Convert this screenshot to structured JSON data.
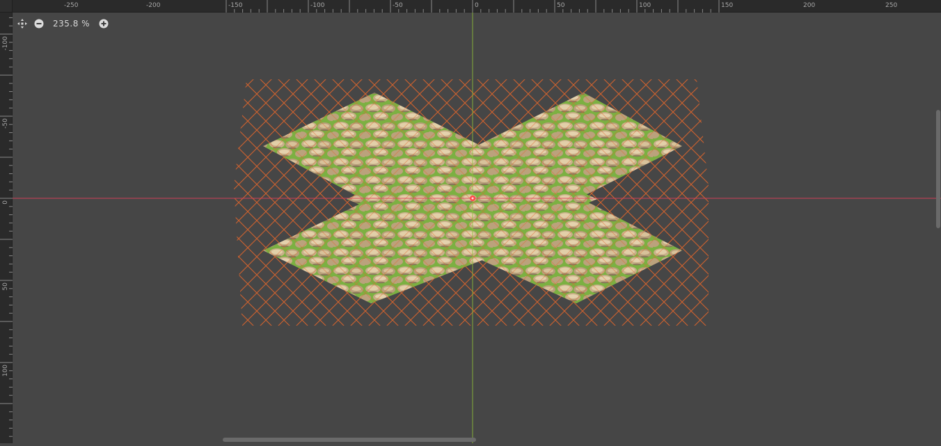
{
  "zoom": {
    "value": "235.8 %",
    "icons": {
      "center": "center-view-icon",
      "out": "zoom-out-icon",
      "in": "zoom-in-icon"
    }
  },
  "rulers": {
    "horizontal_labels": [
      "-250",
      "-200",
      "-150",
      "-100",
      "-50",
      "0",
      "50",
      "100",
      "150",
      "200",
      "250"
    ],
    "vertical_labels": [
      "-100",
      "-50",
      "0",
      "50",
      "100"
    ]
  },
  "colors": {
    "canvas": "#464646",
    "x_axis": "#e0405a",
    "y_axis": "#8fbf3a",
    "grid": "#e0652a",
    "origin": "#ff4a4a"
  }
}
